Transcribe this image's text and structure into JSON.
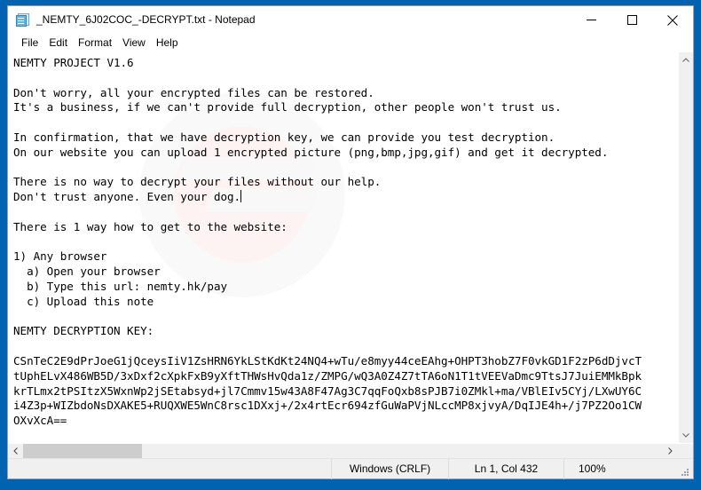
{
  "window": {
    "title": "_NEMTY_6J02COC_-DECRYPT.txt - Notepad",
    "icon": "notepad-icon",
    "caption_buttons": [
      {
        "name": "minimize-button",
        "label": "Minimize"
      },
      {
        "name": "maximize-button",
        "label": "Maximize"
      },
      {
        "name": "close-button",
        "label": "Close"
      }
    ]
  },
  "menu": {
    "items": [
      {
        "name": "menu-file",
        "label": "File"
      },
      {
        "name": "menu-edit",
        "label": "Edit"
      },
      {
        "name": "menu-format",
        "label": "Format"
      },
      {
        "name": "menu-view",
        "label": "View"
      },
      {
        "name": "menu-help",
        "label": "Help"
      }
    ]
  },
  "editor": {
    "text": "NEMTY PROJECT V1.6\n\nDon't worry, all your encrypted files can be restored.\nIt's a business, if we can't provide full decryption, other people won't trust us.\n\nIn confirmation, that we have decryption key, we can provide you test decryption.\nOn our website you can upload 1 encrypted picture (png,bmp,jpg,gif) and get it decrypted.\n\nThere is no way to decrypt your files without our help.\nDon't trust anyone. Even your dog.",
    "text_after_caret": "\n\nThere is 1 way how to get to the website:\n\n1) Any browser\n  a) Open your browser\n  b) Type this url: nemty.hk/pay\n  c) Upload this note\n\nNEMTY DECRYPTION KEY:\n\nCSnTeC2E9dPrJoeG1jQceysIiV1ZsHRN6YkLStKdKt24NQ4+wTu/e8myy44ceEAhg+OHPT3hobZ7F0vkGD1F2zP6dDjvcT\ntUphELvX486WB5D/3xDxf2cXpkFxB9yXftTHWsHvQda1z/ZMPG/wQ3A0Z4Z7tTA6oN1T1tVEEVaDmc9TtsJ7JuiEMMkBpk\nkrTLmx2tPSItzX5WxnWp2jSEtabsyd+jl7Cmmv15w43A8F47Ag3C7qqFoQxb8sPJB7i0ZMkl+ma/VBlEIv5CYj/LXwUY6C\ni4Z3p+WIZbdoNsDXAKE5+RUQXWE5WnC8rsc1DXxj+/2x4rtEcr694zfGuWaPVjNLccMP8xjvyA/DqIJE4h+/j7PZ2Oo1CW\nOXvXcA==",
    "caret_visible": true
  },
  "scrollbars": {
    "vertical": {
      "up_arrow": "scroll-up-arrow",
      "down_arrow": "scroll-down-arrow"
    },
    "horizontal": {
      "left_arrow": "scroll-left-arrow",
      "right_arrow": "scroll-right-arrow"
    }
  },
  "status_bar": {
    "encoding": "Windows (CRLF)",
    "position": "Ln 1, Col 432",
    "zoom": "100%"
  },
  "colors": {
    "desktop": "#0063b1",
    "window_bg": "#ffffff",
    "chrome_bg": "#f0f0f0",
    "scroll_thumb": "#cdcdcd",
    "text": "#000000"
  }
}
